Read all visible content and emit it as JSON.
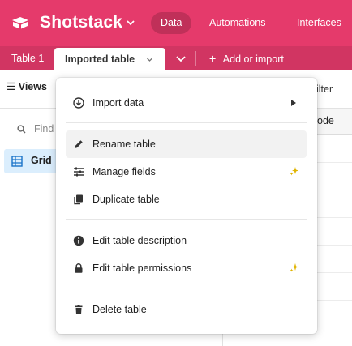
{
  "app": {
    "title": "Shotstack",
    "logo_icon": "open-box-icon",
    "brand_color": "#e53a6b"
  },
  "nav": [
    {
      "label": "Data",
      "active": true
    },
    {
      "label": "Automations",
      "active": false
    },
    {
      "label": "Interfaces",
      "active": false
    }
  ],
  "tables": {
    "inactive_tab": "Table 1",
    "active_tab": "Imported table",
    "add_import": "Add or import"
  },
  "toolbar": {
    "views_label": "Views",
    "filter_label": "Filter",
    "filter_visible_text": "ilter"
  },
  "sidebar": {
    "find_placeholder": "Find",
    "grid_view_label": "Grid view",
    "grid_view_visible_text": "Grid"
  },
  "grid": {
    "column_header": "Code",
    "column_header_visible_text": "ode"
  },
  "menu": {
    "items": [
      {
        "label": "Import data",
        "icon": "import-arrow-icon",
        "submenu": true
      },
      {
        "label": "Rename table",
        "icon": "pencil-icon",
        "hovered": true
      },
      {
        "label": "Manage fields",
        "icon": "sliders-icon",
        "upgrade": true
      },
      {
        "label": "Duplicate table",
        "icon": "copy-icon"
      },
      {
        "label": "Edit table description",
        "icon": "info-icon"
      },
      {
        "label": "Edit table permissions",
        "icon": "lock-icon",
        "upgrade": true
      },
      {
        "label": "Delete table",
        "icon": "trash-icon"
      }
    ]
  }
}
